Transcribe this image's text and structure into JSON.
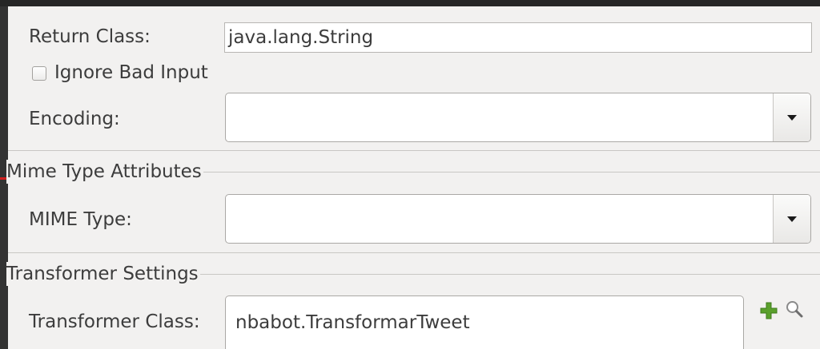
{
  "return_class": {
    "label": "Return Class:",
    "value": "java.lang.String"
  },
  "ignore_bad_input": {
    "label": "Ignore Bad Input",
    "checked": false
  },
  "encoding": {
    "label": "Encoding:",
    "value": ""
  },
  "mime_section": {
    "title": "Mime Type Attributes",
    "mime_type_label": "MIME Type:",
    "mime_type_value": ""
  },
  "transformer_section": {
    "title": "Transformer Settings",
    "class_label": "Transformer Class:",
    "class_value": "nbabot.TransformarTweet"
  },
  "icons": {
    "add": "plus-icon",
    "search": "magnifier-icon",
    "dropdown": "chevron-down-icon",
    "add_color": "#5aa02c"
  }
}
